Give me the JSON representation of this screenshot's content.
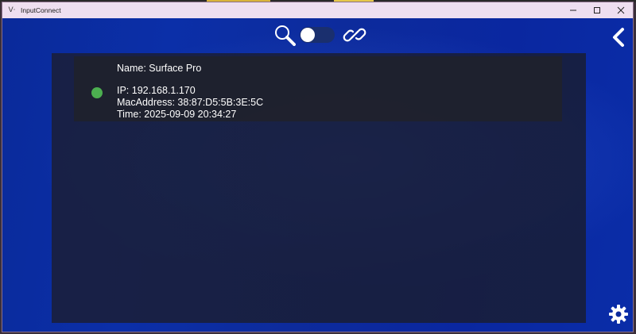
{
  "window": {
    "title": "InputConnect",
    "icon": "app-icon"
  },
  "toolbar": {
    "search_icon": "magnifier-icon",
    "toggle_on": false,
    "link_icon": "chain-link-icon",
    "back_icon": "chevron-left-icon",
    "settings_icon": "gear-icon"
  },
  "devices": [
    {
      "status": "online",
      "status_color": "#4caf50",
      "name": "Name: Surface Pro",
      "ip": "IP: 192.168.1.170",
      "mac": "MacAddress: 38:87:D5:5B:3E:5C",
      "time": "Time: 2025-09-09 20:34:27"
    }
  ],
  "colors": {
    "background": "#0b2fa8",
    "panel": "#1e2240",
    "titlebar": "#eedff0"
  }
}
